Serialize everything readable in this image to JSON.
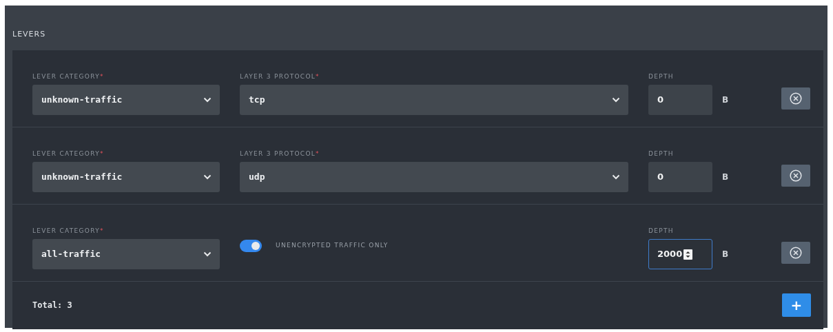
{
  "panel": {
    "title": "LEVERS"
  },
  "levers": [
    {
      "kind": "protocol",
      "category_label": "LEVER CATEGORY",
      "category_required": "*",
      "category": "unknown-traffic",
      "protocol_label": "LAYER 3 PROTOCOL",
      "protocol_required": "*",
      "protocol": "tcp",
      "depth_label": "DEPTH",
      "depth": "0",
      "depth_focused": false,
      "unit": "B"
    },
    {
      "kind": "protocol",
      "category_label": "LEVER CATEGORY",
      "category_required": "*",
      "category": "unknown-traffic",
      "protocol_label": "LAYER 3 PROTOCOL",
      "protocol_required": "*",
      "protocol": "udp",
      "depth_label": "DEPTH",
      "depth": "0",
      "depth_focused": false,
      "unit": "B"
    },
    {
      "kind": "toggle",
      "category_label": "LEVER CATEGORY",
      "category_required": "*",
      "category": "all-traffic",
      "toggle_on": true,
      "toggle_label": "UNENCRYPTED TRAFFIC ONLY",
      "depth_label": "DEPTH",
      "depth": "2000",
      "depth_focused": true,
      "unit": "B"
    }
  ],
  "footer": {
    "total": "Total: 3",
    "add_button": "+"
  }
}
